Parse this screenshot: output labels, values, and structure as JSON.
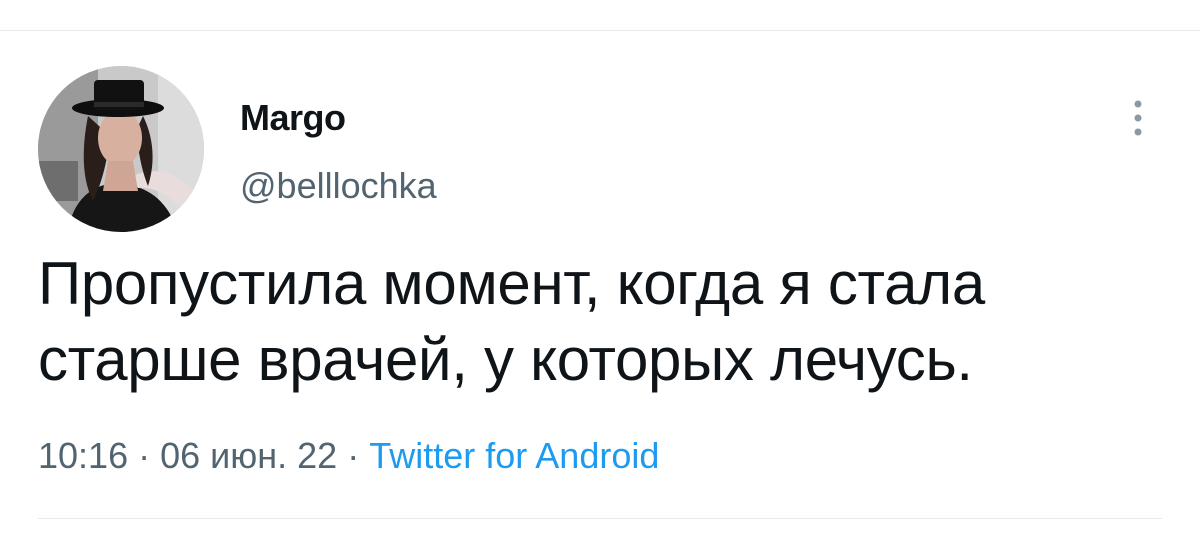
{
  "tweet": {
    "display_name": "Margo",
    "handle": "@belllochka",
    "text_line1": "Пропустила момент, когда я стала",
    "text_line2": "старше врачей, у которых лечусь.",
    "time": "10:16",
    "date": "06 июн. 22",
    "separator": "·",
    "source": "Twitter for Android"
  },
  "icons": {
    "avatar": "profile-photo",
    "more": "more-vertical-icon"
  },
  "colors": {
    "text": "#0f1419",
    "secondary": "#536471",
    "link": "#1d9bf0",
    "divider": "#e7e9ea"
  }
}
